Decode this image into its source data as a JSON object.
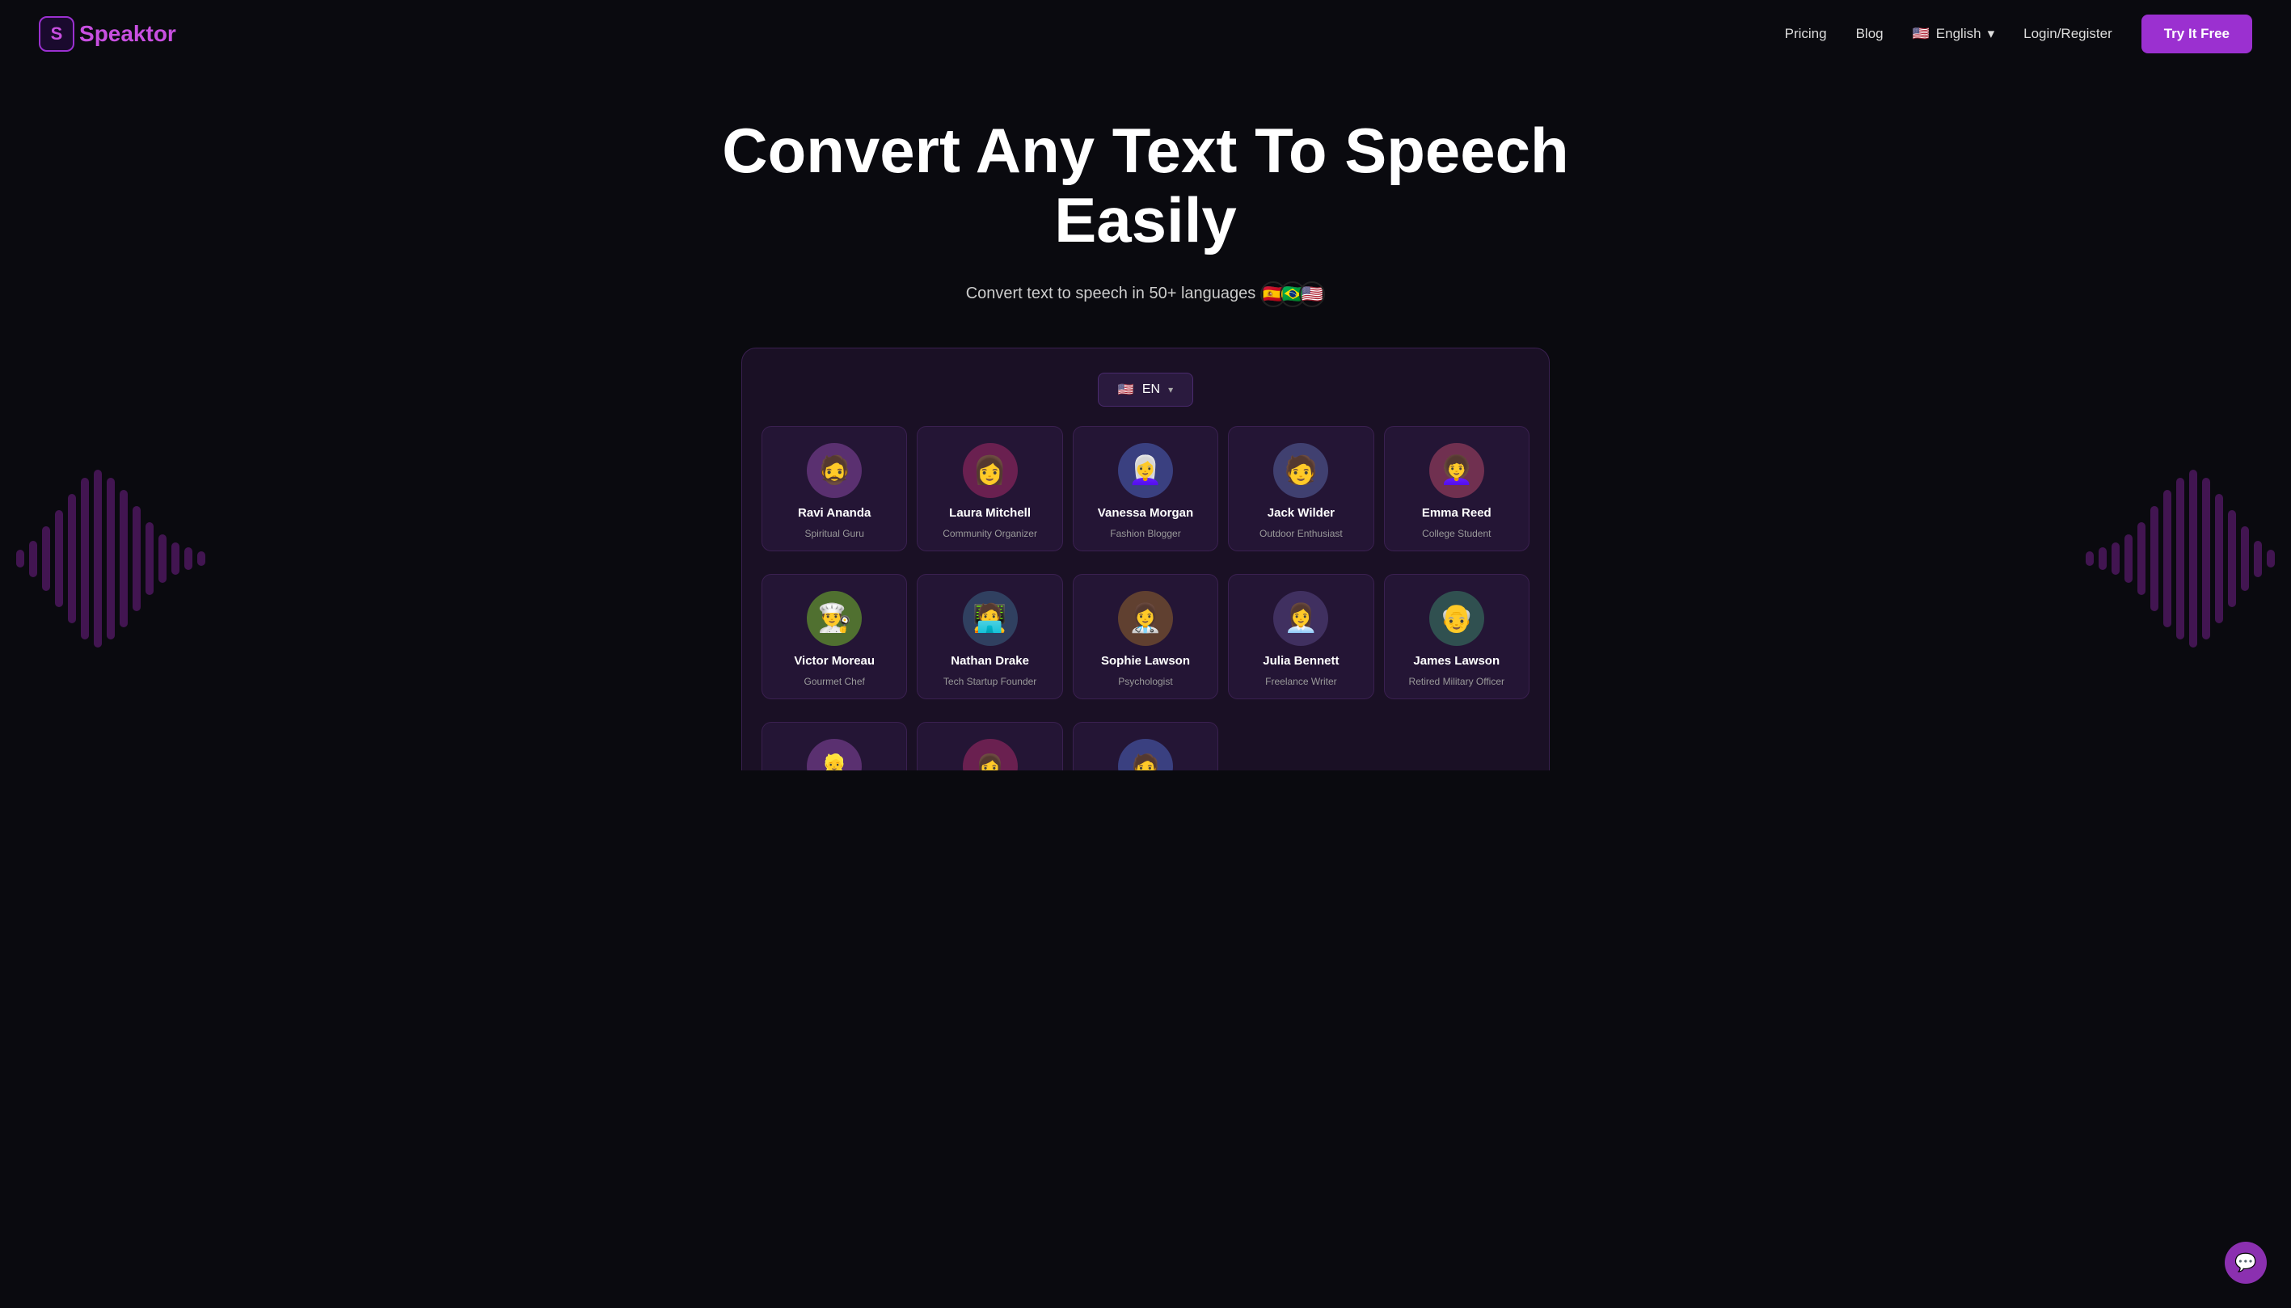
{
  "nav": {
    "logo_letter": "S",
    "logo_name": "peaktor",
    "pricing_label": "Pricing",
    "blog_label": "Blog",
    "language_label": "English",
    "login_label": "Login/Register",
    "cta_label": "Try It Free"
  },
  "hero": {
    "title": "Convert Any Text To Speech Easily",
    "subtitle": "Convert text to speech in 50+ languages",
    "flags": [
      "🇪🇸",
      "🇧🇷",
      "🇺🇸"
    ]
  },
  "app": {
    "lang_selector": {
      "flag": "🇺🇸",
      "code": "EN"
    },
    "voices_row1": [
      {
        "name": "Ravi Ananda",
        "role": "Spiritual Guru",
        "emoji": "🧔"
      },
      {
        "name": "Laura Mitchell",
        "role": "Community Organizer",
        "emoji": "👩"
      },
      {
        "name": "Vanessa Morgan",
        "role": "Fashion Blogger",
        "emoji": "👩‍🦳"
      },
      {
        "name": "Jack Wilder",
        "role": "Outdoor Enthusiast",
        "emoji": "🧑"
      },
      {
        "name": "Emma Reed",
        "role": "College Student",
        "emoji": "👩‍🦱"
      }
    ],
    "voices_row2": [
      {
        "name": "Victor Moreau",
        "role": "Gourmet Chef",
        "emoji": "👨‍🍳"
      },
      {
        "name": "Nathan Drake",
        "role": "Tech Startup Founder",
        "emoji": "🧑‍💻"
      },
      {
        "name": "Sophie Lawson",
        "role": "Psychologist",
        "emoji": "👩‍⚕️"
      },
      {
        "name": "Julia Bennett",
        "role": "Freelance Writer",
        "emoji": "👩‍💼"
      },
      {
        "name": "James Lawson",
        "role": "Retired Military Officer",
        "emoji": "👴"
      }
    ],
    "voices_row3_partial": [
      {
        "name": "",
        "role": "",
        "emoji": "👱"
      },
      {
        "name": "",
        "role": "",
        "emoji": "👩"
      },
      {
        "name": "",
        "role": "",
        "emoji": "🧑"
      }
    ]
  },
  "wave_bars_left": [
    18,
    35,
    55,
    80,
    100,
    120,
    130,
    125,
    110,
    90,
    70,
    50,
    40,
    30,
    22
  ],
  "wave_bars_right": [
    22,
    30,
    40,
    50,
    70,
    90,
    110,
    125,
    130,
    120,
    100,
    80,
    55,
    35,
    18
  ]
}
